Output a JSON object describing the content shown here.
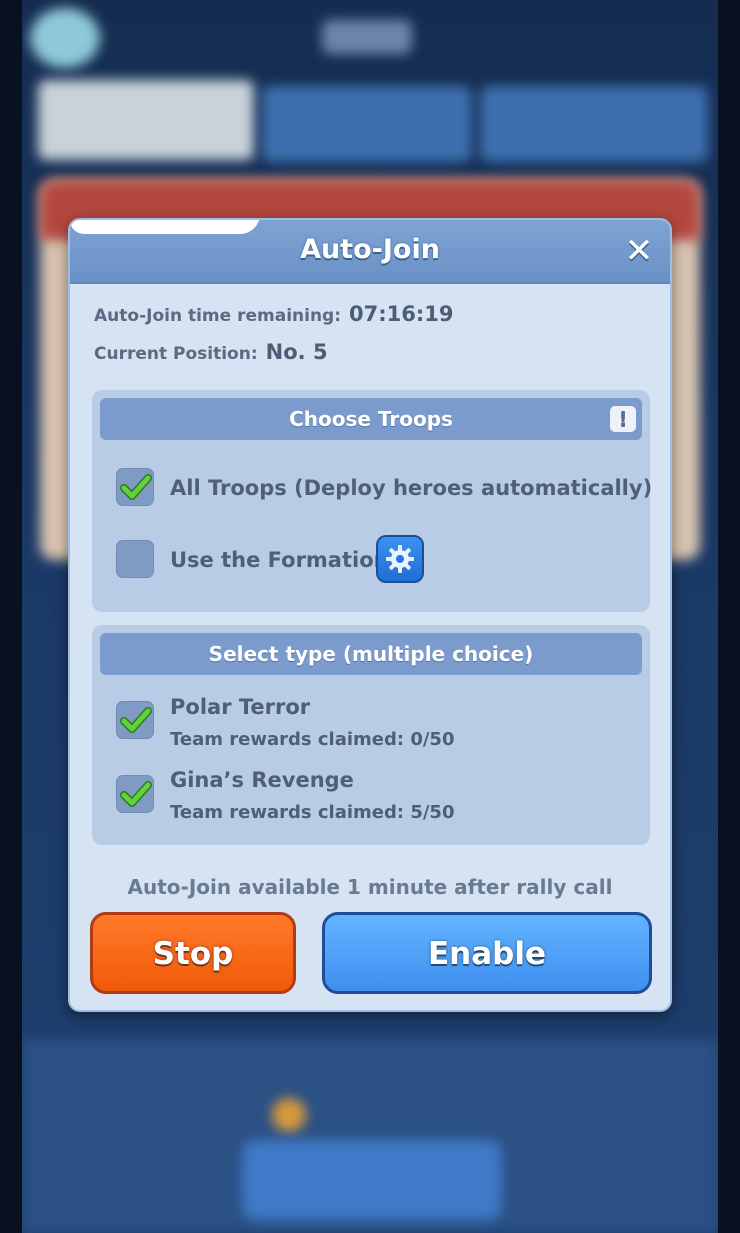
{
  "dialog": {
    "title": "Auto-Join",
    "close_icon": "close-icon",
    "time_label": "Auto-Join time remaining:",
    "time_value": "07:16:19",
    "position_label": "Current Position:",
    "position_value": "No. 5"
  },
  "troops": {
    "header": "Choose Troops",
    "info_icon": "!",
    "options": [
      {
        "label": "All Troops (Deploy heroes automatically)",
        "checked": true
      },
      {
        "label": "Use the Formation",
        "checked": false,
        "icon": "gear-icon"
      }
    ]
  },
  "types": {
    "header": "Select type (multiple choice)",
    "options": [
      {
        "label": "Polar Terror",
        "sub": "Team rewards claimed: 0/50",
        "checked": true
      },
      {
        "label": "Gina’s Revenge",
        "sub": "Team rewards claimed: 5/50",
        "checked": true
      }
    ]
  },
  "note": "Auto-Join available 1 minute after rally call",
  "buttons": {
    "stop": "Stop",
    "enable": "Enable"
  },
  "colors": {
    "stop_button": "#f05a08",
    "enable_button": "#3e8ff0",
    "checkmark": "#58c43a"
  }
}
